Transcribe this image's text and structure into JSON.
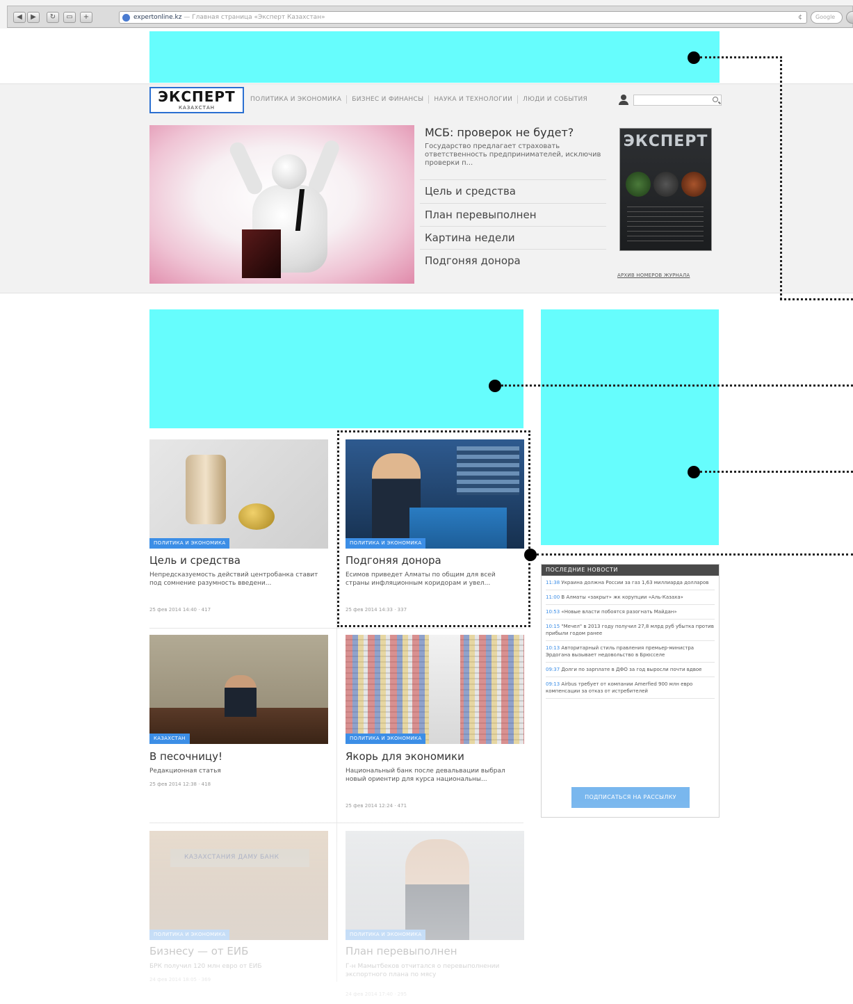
{
  "browser": {
    "url_domain": "expertonline.kz",
    "url_rest": " — Главная страница «Эксперт Казахстан»"
  },
  "header": {
    "logo_main": "ЭКСПЕРТ",
    "logo_sub": "КАЗАХСТАН",
    "nav": [
      "ПОЛИТИКА И ЭКОНОМИКА",
      "БИЗНЕС И ФИНАНСЫ",
      "НАУКА И ТЕХНОЛОГИИ",
      "ЛЮДИ И СОБЫТИЯ"
    ]
  },
  "hero": {
    "lead_title": "МСБ: проверок не будет?",
    "lead_text": "Государство предлагает страховать ответственность предпринимателей, исключив проверки п...",
    "links": [
      "Цель и средства",
      "План перевыполнен",
      "Картина недели",
      "Подгоняя донора"
    ],
    "magazine_title": "ЭКСПЕРТ",
    "archive_link": "АРХИВ НОМЕРОВ ЖУРНАЛА"
  },
  "articles": [
    {
      "tag": "ПОЛИТИКА И ЭКОНОМИКА",
      "title": "Цель и средства",
      "text": "Непредсказуемость действий центробанка ставит под сомнение разумность введени...",
      "meta": "25 фев 2014 14:40 · 417"
    },
    {
      "tag": "ПОЛИТИКА И ЭКОНОМИКА",
      "title": "Подгоняя донора",
      "text": "Есимов приведет Алматы по общим для всей страны инфляционным коридорам и увел...",
      "meta": "25 фев 2014 14:33 · 337"
    },
    {
      "tag": "КАЗАХСТАН",
      "title": "В песочницу!",
      "text": "Редакционная статья",
      "meta": "25 фев 2014 12:38 · 418"
    },
    {
      "tag": "ПОЛИТИКА И ЭКОНОМИКА",
      "title": "Якорь для экономики",
      "text": "Национальный банк после девальвации выбрал новый ориентир для курса национальны...",
      "meta": "25 фев 2014 12:24 · 471"
    },
    {
      "tag": "ПОЛИТИКА И ЭКОНОМИКА",
      "title": "Бизнесу — от ЕИБ",
      "text": "БРК получил 120 млн евро от ЕИБ",
      "meta": "24 фев 2014 18:05 · 369",
      "sign": "КАЗАХСТАНИЯ ДАМУ БАНК"
    },
    {
      "tag": "ПОЛИТИКА И ЭКОНОМИКА",
      "title": "План перевыполнен",
      "text": "Г-н Мамытбеков отчитался о перевыполнении экспортного плана по мясу",
      "meta": "24 фев 2014 17:40 · 295"
    }
  ],
  "news": {
    "heading": "ПОСЛЕДНИЕ НОВОСТИ",
    "items": [
      {
        "time": "11:38",
        "text": "Украина должна России за газ 1,63 миллиарда долларов"
      },
      {
        "time": "11:00",
        "text": "В Алматы «закрыт» жк корупции «Аль-Казаха»"
      },
      {
        "time": "10:53",
        "text": "«Новые власти побоятся разогнать Майдан»"
      },
      {
        "time": "10:15",
        "text": "\"Мечел\" в 2013 году получил 27,8 млрд руб убытка против прибыли годом ранее"
      },
      {
        "time": "10:13",
        "text": "Авторитарный стиль правления премьер-министра Эрдогана вызывает недовольство в Брюсселе"
      },
      {
        "time": "09:37",
        "text": "Долги по зарплате в ДФО за год выросли почти вдвое"
      },
      {
        "time": "09:13",
        "text": "Airbus требует от компании Amerfied 900 млн евро компенсации за отказ от истребителей"
      }
    ],
    "subscribe": "ПОДПИСАТЬСЯ НА РАССЫЛКУ"
  }
}
